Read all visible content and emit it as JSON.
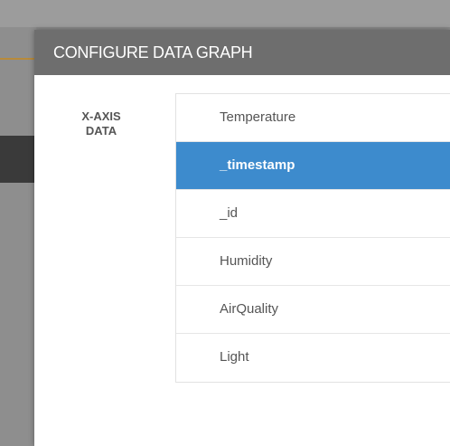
{
  "modal": {
    "title": "CONFIGURE DATA GRAPH",
    "field_label_line1": "X-AXIS",
    "field_label_line2": "DATA",
    "options": [
      {
        "label": "Temperature",
        "selected": false
      },
      {
        "label": "_timestamp",
        "selected": true
      },
      {
        "label": "_id",
        "selected": false
      },
      {
        "label": "Humidity",
        "selected": false
      },
      {
        "label": "AirQuality",
        "selected": false
      },
      {
        "label": "Light",
        "selected": false
      }
    ]
  },
  "colors": {
    "header": "#6e6e6e",
    "selected": "#3d8bcd",
    "overlay": "#8a8a8a"
  }
}
